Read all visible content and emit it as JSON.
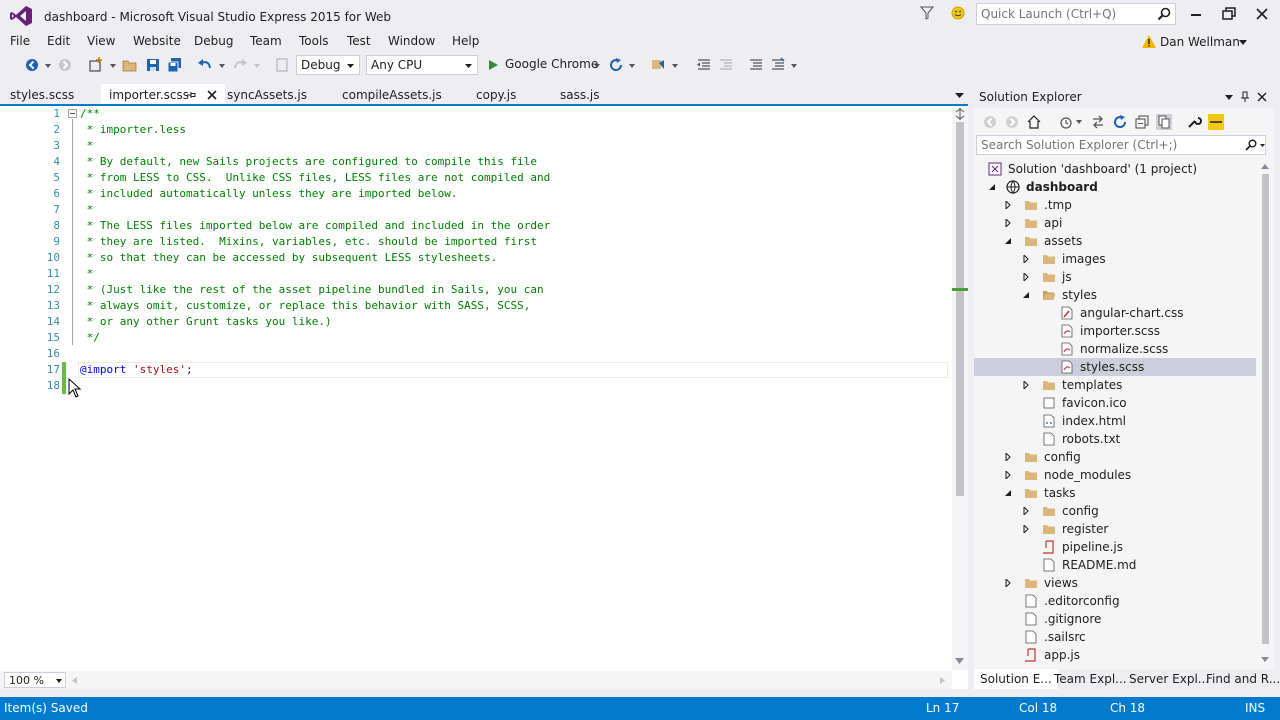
{
  "window": {
    "title": "dashboard - Microsoft Visual Studio Express 2015 for Web",
    "quick_launch_placeholder": "Quick Launch (Ctrl+Q)"
  },
  "menu": [
    "File",
    "Edit",
    "View",
    "Website",
    "Debug",
    "Team",
    "Tools",
    "Test",
    "Window",
    "Help"
  ],
  "user": {
    "name": "Dan Wellman"
  },
  "toolbar": {
    "configuration": "Debug",
    "platform": "Any CPU",
    "run_target": "Google Chrome"
  },
  "tabs": {
    "left": "styles.scss",
    "active": "importer.scss",
    "others": [
      "syncAssets.js",
      "compileAssets.js",
      "copy.js",
      "sass.js"
    ]
  },
  "editor": {
    "line_numbers": [
      "1",
      "2",
      "3",
      "4",
      "5",
      "6",
      "7",
      "8",
      "9",
      "10",
      "11",
      "12",
      "13",
      "14",
      "15",
      "16",
      "17",
      "18"
    ],
    "lines": [
      "/**",
      " * importer.less",
      " *",
      " * By default, new Sails projects are configured to compile this file",
      " * from LESS to CSS.  Unlike CSS files, LESS files are not compiled and",
      " * included automatically unless they are imported below.",
      " *",
      " * The LESS files imported below are compiled and included in the order",
      " * they are listed.  Mixins, variables, etc. should be imported first",
      " * so that they can be accessed by subsequent LESS stylesheets.",
      " *",
      " * (Just like the rest of the asset pipeline bundled in Sails, you can",
      " * always omit, customize, or replace this behavior with SASS, SCSS,",
      " * or any other Grunt tasks you like.)",
      " */",
      "",
      "",
      ""
    ],
    "import_keyword": "@import",
    "import_string": "'styles'",
    "import_end": ";",
    "zoom": "100 %"
  },
  "solution_explorer": {
    "title": "Solution Explorer",
    "search_placeholder": "Search Solution Explorer (Ctrl+;)",
    "tree": [
      {
        "label": "Solution 'dashboard' (1 project)",
        "level": 0,
        "icon": "solution",
        "expander": "none"
      },
      {
        "label": "dashboard",
        "level": 1,
        "icon": "globe",
        "expander": "expanded",
        "bold": true
      },
      {
        "label": ".tmp",
        "level": 2,
        "icon": "folder",
        "expander": "collapsed"
      },
      {
        "label": "api",
        "level": 2,
        "icon": "folder",
        "expander": "collapsed"
      },
      {
        "label": "assets",
        "level": 2,
        "icon": "folder",
        "expander": "expanded"
      },
      {
        "label": "images",
        "level": 3,
        "icon": "folder",
        "expander": "collapsed"
      },
      {
        "label": "js",
        "level": 3,
        "icon": "folder",
        "expander": "collapsed"
      },
      {
        "label": "styles",
        "level": 3,
        "icon": "folder-open",
        "expander": "expanded"
      },
      {
        "label": "angular-chart.css",
        "level": 4,
        "icon": "css-file",
        "expander": "none"
      },
      {
        "label": "importer.scss",
        "level": 4,
        "icon": "scss-file",
        "expander": "none"
      },
      {
        "label": "normalize.scss",
        "level": 4,
        "icon": "scss-file",
        "expander": "none"
      },
      {
        "label": "styles.scss",
        "level": 4,
        "icon": "scss-file",
        "expander": "none",
        "selected": true
      },
      {
        "label": "templates",
        "level": 3,
        "icon": "folder",
        "expander": "collapsed"
      },
      {
        "label": "favicon.ico",
        "level": 3,
        "icon": "ico-file",
        "expander": "none"
      },
      {
        "label": "index.html",
        "level": 3,
        "icon": "html-file",
        "expander": "none"
      },
      {
        "label": "robots.txt",
        "level": 3,
        "icon": "text-file",
        "expander": "none"
      },
      {
        "label": "config",
        "level": 2,
        "icon": "folder",
        "expander": "collapsed"
      },
      {
        "label": "node_modules",
        "level": 2,
        "icon": "folder",
        "expander": "collapsed"
      },
      {
        "label": "tasks",
        "level": 2,
        "icon": "folder",
        "expander": "expanded"
      },
      {
        "label": "config",
        "level": 3,
        "icon": "folder",
        "expander": "collapsed"
      },
      {
        "label": "register",
        "level": 3,
        "icon": "folder",
        "expander": "collapsed"
      },
      {
        "label": "pipeline.js",
        "level": 3,
        "icon": "js-file",
        "expander": "none"
      },
      {
        "label": "README.md",
        "level": 3,
        "icon": "text-file",
        "expander": "none"
      },
      {
        "label": "views",
        "level": 2,
        "icon": "folder",
        "expander": "collapsed"
      },
      {
        "label": ".editorconfig",
        "level": 2,
        "icon": "text-file",
        "expander": "none"
      },
      {
        "label": ".gitignore",
        "level": 2,
        "icon": "text-file",
        "expander": "none"
      },
      {
        "label": ".sailsrc",
        "level": 2,
        "icon": "text-file",
        "expander": "none"
      },
      {
        "label": "app.js",
        "level": 2,
        "icon": "js-file",
        "expander": "none"
      }
    ],
    "bottom_tabs": [
      "Solution E...",
      "Team Expl...",
      "Server Expl...",
      "Find and R..."
    ]
  },
  "status": {
    "message": "Item(s) Saved",
    "line": "Ln 17",
    "col": "Col 18",
    "ch": "Ch 18",
    "mode": "INS"
  },
  "colors": {
    "accent": "#007acc",
    "vs_purple": "#68217a",
    "comment": "#008000",
    "keyword": "#0000ff",
    "string": "#a31515",
    "line_number": "#2b91af"
  }
}
